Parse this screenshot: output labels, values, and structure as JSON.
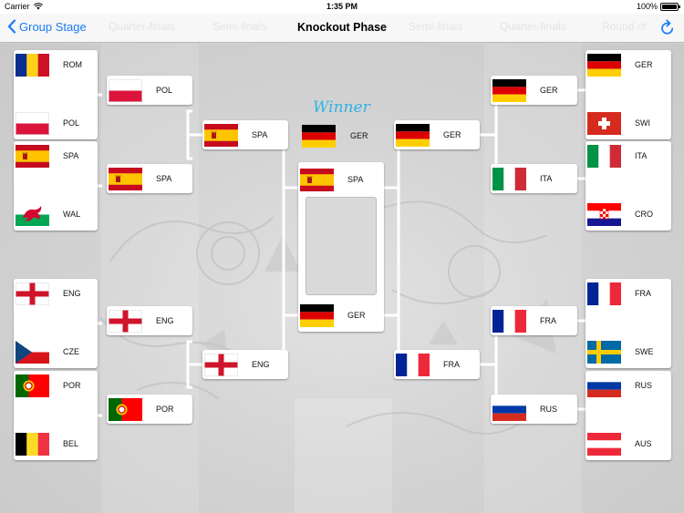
{
  "status_bar": {
    "carrier": "Carrier",
    "time": "1:35 PM",
    "battery": "100%",
    "battery_level": 1.0
  },
  "nav": {
    "back_label": "Group Stage",
    "title": "Knockout Phase",
    "faded_tabs": [
      "Quarter-finals",
      "Semi-finals",
      "Semi-finals",
      "Quarter-finals",
      "Round of"
    ]
  },
  "winner": {
    "label": "Winner",
    "team": "GER"
  },
  "teams": {
    "r16_left": [
      "ROM",
      "POL",
      "SPA",
      "WAL",
      "ENG",
      "CZE",
      "POR",
      "BEL"
    ],
    "qf_left": [
      "POL",
      "SPA",
      "ENG",
      "POR"
    ],
    "sf_left": [
      "SPA",
      "ENG"
    ],
    "final": [
      "SPA",
      "GER"
    ],
    "sf_right": [
      "GER",
      "FRA"
    ],
    "qf_right": [
      "GER",
      "ITA",
      "FRA",
      "RUS"
    ],
    "r16_right": [
      "GER",
      "SWI",
      "ITA",
      "CRO",
      "FRA",
      "SWE",
      "RUS",
      "AUS"
    ]
  },
  "colors": {
    "accent": "#1b7cf5",
    "winner_text": "#2fb3e6",
    "bracket_line": "#ffffff"
  }
}
